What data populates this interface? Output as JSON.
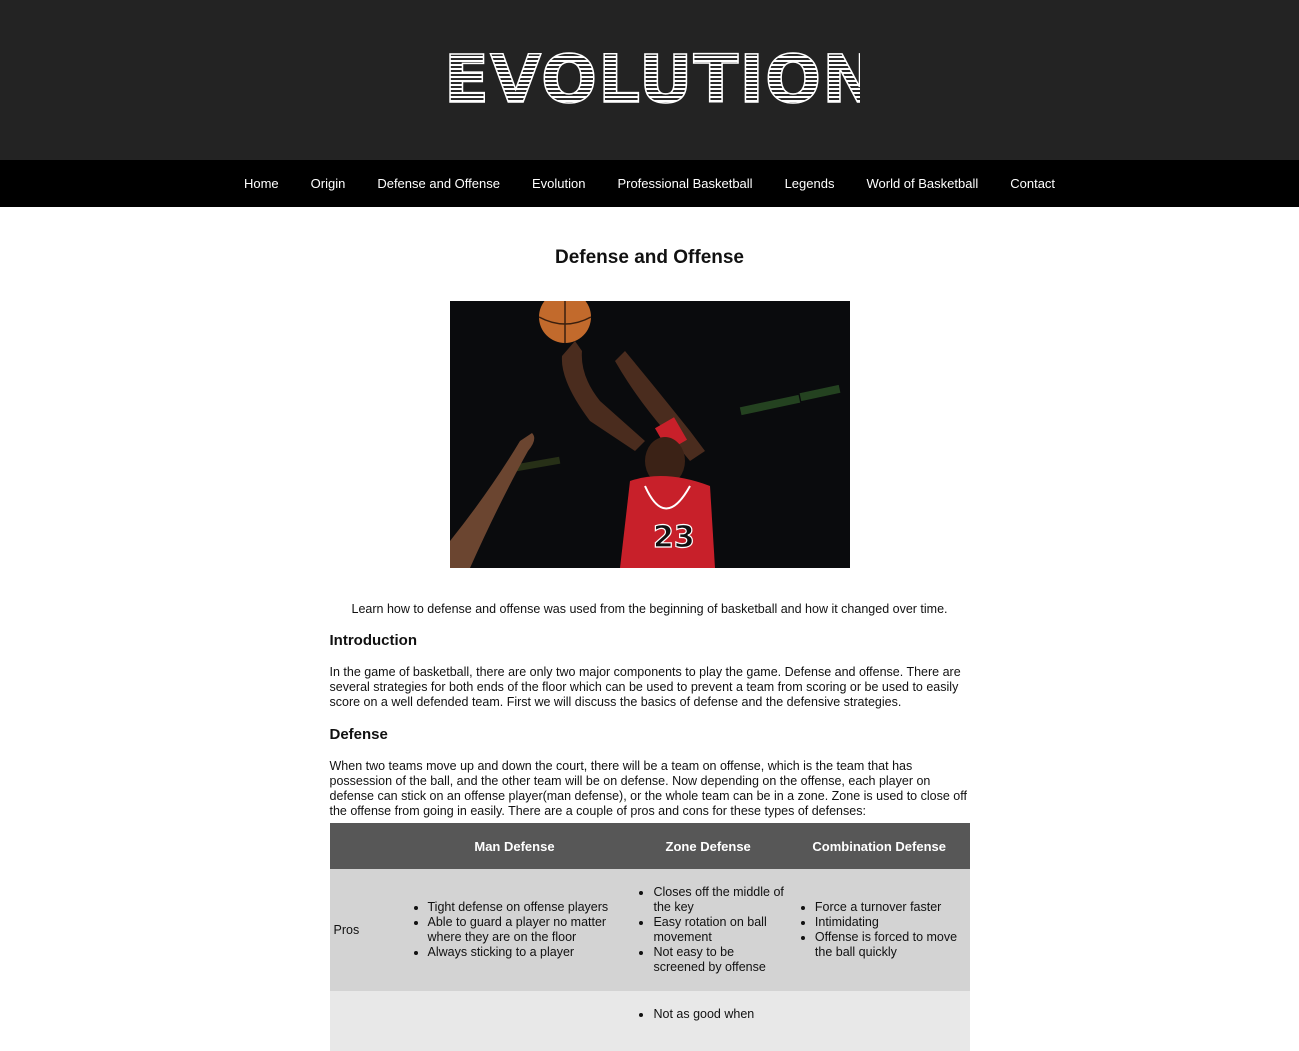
{
  "header": {
    "logo_text": "EVOLUTION"
  },
  "nav": {
    "items": [
      {
        "label": "Home"
      },
      {
        "label": "Origin"
      },
      {
        "label": "Defense and Offense"
      },
      {
        "label": "Evolution"
      },
      {
        "label": "Professional Basketball"
      },
      {
        "label": "Legends"
      },
      {
        "label": "World of Basketball"
      },
      {
        "label": "Contact"
      }
    ]
  },
  "main": {
    "title": "Defense and Offense",
    "lead": "Learn how to defense and offense was used from the beginning of basketball and how it changed over time.",
    "intro_heading": "Introduction",
    "intro_text": "In the game of basketball, there are only two major components to play the game. Defense and offense. There are several strategies for both ends of the floor which can be used to prevent a team from scoring or be used to easily score on a well defended team. First we will discuss the basics of defense and the defensive strategies.",
    "defense_heading": "Defense",
    "defense_text": "When two teams move up and down the court, there will be a team on offense, which is the team that has possession of the ball, and the other team will be on defense. Now depending on the offense, each player on defense can stick on an offense player(man defense), or the whole team can be in a zone. Zone is used to close off the offense from going in easily. There are a couple of pros and cons for these types of defenses:",
    "table": {
      "headers": [
        "",
        "Man Defense",
        "Zone Defense",
        "Combination Defense"
      ],
      "pros_label": "Pros",
      "pros": {
        "man": [
          "Tight defense on offense players",
          "Able to guard a player no matter where they are on the floor",
          "Always sticking to a player"
        ],
        "zone": [
          "Closes off the middle of the key",
          "Easy rotation on ball movement",
          "Not easy to be screened by offense"
        ],
        "combo": [
          "Force a turnover faster",
          "Intimidating",
          "Offense is forced to move the ball quickly"
        ]
      },
      "cons_label": "",
      "cons": {
        "zone": [
          "Not as good when"
        ]
      }
    }
  },
  "colors": {
    "header_bg": "#232323",
    "nav_bg": "#000000",
    "table_header_bg": "#575757",
    "pros_row_bg": "#d3d3d3",
    "cons_row_bg": "#e8e8e8",
    "jersey_red": "#c8202a"
  }
}
